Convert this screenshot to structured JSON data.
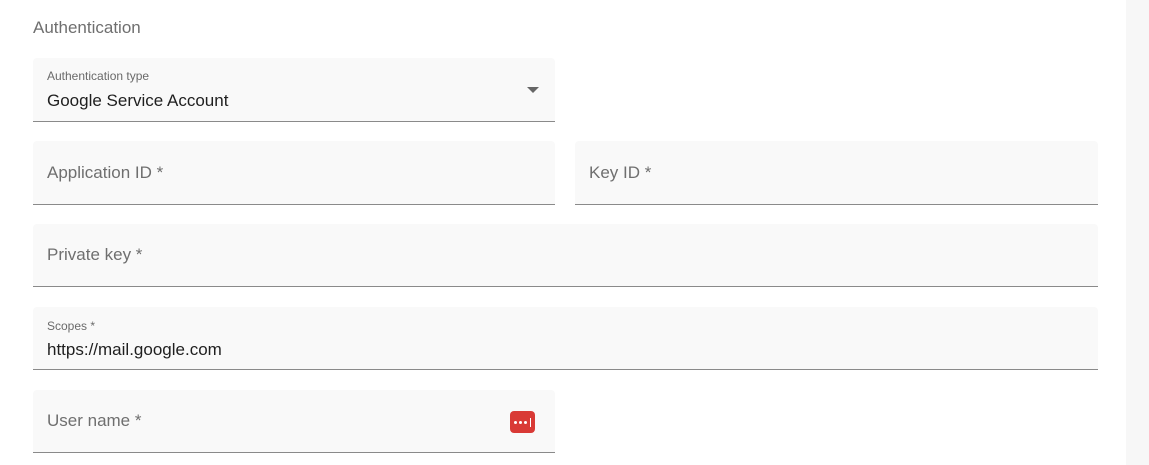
{
  "section": {
    "title": "Authentication"
  },
  "fields": {
    "auth_type": {
      "label": "Authentication type",
      "value": "Google Service Account"
    },
    "application_id": {
      "label": "Application ID *"
    },
    "key_id": {
      "label": "Key ID *"
    },
    "private_key": {
      "label": "Private key *"
    },
    "scopes": {
      "label": "Scopes *",
      "value": "https://mail.google.com"
    },
    "user_name": {
      "label": "User name *"
    }
  },
  "icons": {
    "dropdown": "chevron-down-icon",
    "password_manager": "password-manager-icon"
  },
  "colors": {
    "password_icon_bg": "#d93a36",
    "field_bg": "#f9f9f9",
    "underline": "#8a8a8a"
  }
}
